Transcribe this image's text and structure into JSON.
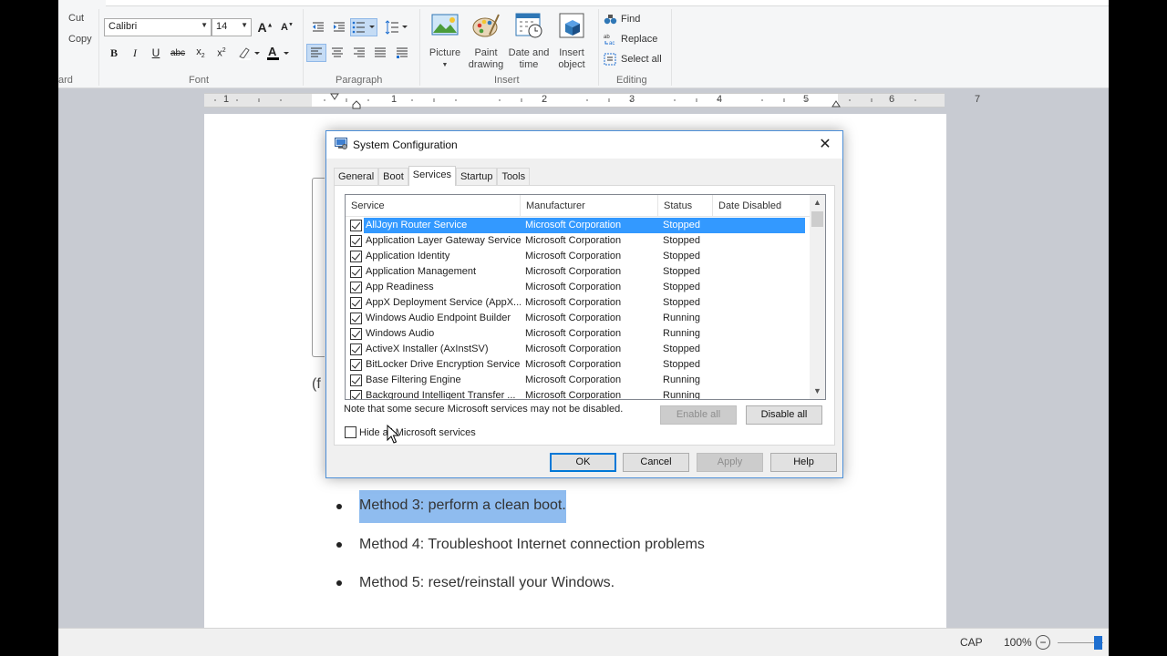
{
  "ribbon": {
    "clipboard": {
      "cut": "Cut",
      "copy": "Copy",
      "label": "ard"
    },
    "font": {
      "name": "Calibri",
      "size": "14",
      "label": "Font"
    },
    "paragraph": {
      "label": "Paragraph"
    },
    "insert": {
      "label": "Insert",
      "picture": "Picture",
      "paint_line1": "Paint",
      "paint_line2": "drawing",
      "date_line1": "Date and",
      "date_line2": "time",
      "object_line1": "Insert",
      "object_line2": "object"
    },
    "editing": {
      "label": "Editing",
      "find": "Find",
      "replace": "Replace",
      "select_all": "Select all"
    }
  },
  "ruler": {
    "marks": [
      "1",
      "1",
      "2",
      "3",
      "4",
      "5",
      "6",
      "7"
    ]
  },
  "document": {
    "partial": "(f",
    "bullets": [
      "Method 3: perform a clean boot.",
      "Method 4: Troubleshoot Internet connection problems",
      "Method 5: reset/reinstall your Windows."
    ]
  },
  "dialog": {
    "title": "System Configuration",
    "tabs": [
      "General",
      "Boot",
      "Services",
      "Startup",
      "Tools"
    ],
    "columns": [
      "Service",
      "Manufacturer",
      "Status",
      "Date Disabled"
    ],
    "rows": [
      [
        "AllJoyn Router Service",
        "Microsoft Corporation",
        "Stopped"
      ],
      [
        "Application Layer Gateway Service",
        "Microsoft Corporation",
        "Stopped"
      ],
      [
        "Application Identity",
        "Microsoft Corporation",
        "Stopped"
      ],
      [
        "Application Management",
        "Microsoft Corporation",
        "Stopped"
      ],
      [
        "App Readiness",
        "Microsoft Corporation",
        "Stopped"
      ],
      [
        "AppX Deployment Service (AppX...",
        "Microsoft Corporation",
        "Stopped"
      ],
      [
        "Windows Audio Endpoint Builder",
        "Microsoft Corporation",
        "Running"
      ],
      [
        "Windows Audio",
        "Microsoft Corporation",
        "Running"
      ],
      [
        "ActiveX Installer (AxInstSV)",
        "Microsoft Corporation",
        "Stopped"
      ],
      [
        "BitLocker Drive Encryption Service",
        "Microsoft Corporation",
        "Stopped"
      ],
      [
        "Base Filtering Engine",
        "Microsoft Corporation",
        "Running"
      ],
      [
        "Background Intelligent Transfer ...",
        "Microsoft Corporation",
        "Running"
      ]
    ],
    "note": "Note that some secure Microsoft services may not be disabled.",
    "enable_all": "Enable all",
    "disable_all": "Disable all",
    "hide_ms": "Hide all Microsoft services",
    "ok": "OK",
    "cancel": "Cancel",
    "apply": "Apply",
    "help": "Help"
  },
  "status": {
    "caps": "CAP",
    "zoom": "100%"
  },
  "colors": {
    "accent": "#0078d7",
    "selection": "#3399ff",
    "text_selection": "#8fbcef"
  }
}
